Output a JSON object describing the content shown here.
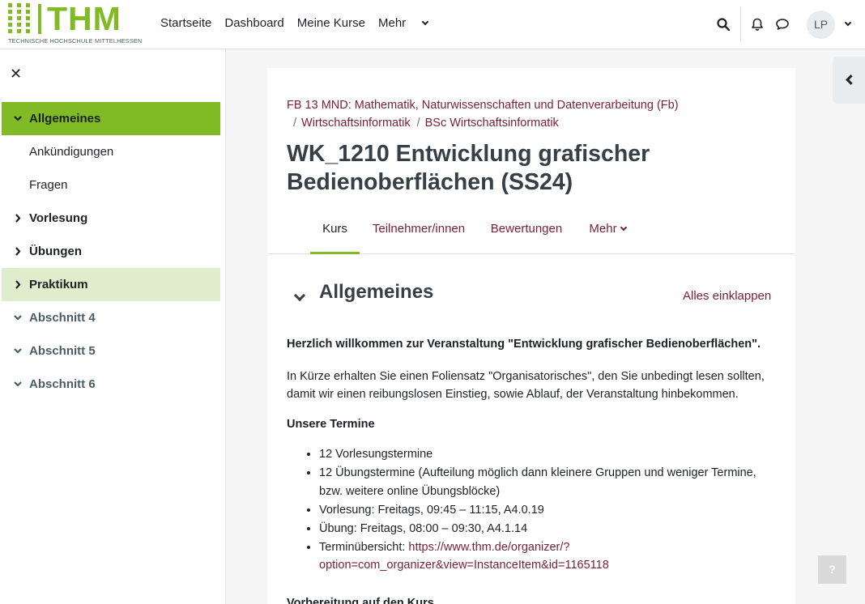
{
  "header": {
    "logo_text": "THM",
    "logo_subtitle": "TECHNISCHE HOCHSCHULE MITTELHESSEN",
    "nav": [
      "Startseite",
      "Dashboard",
      "Meine Kurse",
      "Mehr"
    ],
    "avatar_initials": "LP",
    "icons": [
      "search-icon",
      "bell-icon",
      "message-icon",
      "chevron-down-icon"
    ]
  },
  "drawer": {
    "close_icon": "close-icon",
    "items": [
      {
        "label": "Allgemeines",
        "state": "expanded",
        "bold": true,
        "active": true
      },
      {
        "label": "Ankündigungen",
        "state": "child"
      },
      {
        "label": "Fragen",
        "state": "child"
      },
      {
        "label": "Vorlesung",
        "state": "collapsed",
        "bold": true
      },
      {
        "label": "Übungen",
        "state": "collapsed",
        "bold": true
      },
      {
        "label": "Praktikum",
        "state": "collapsed",
        "bold": true,
        "highlighted": true
      },
      {
        "label": "Abschnitt 4",
        "state": "expanded",
        "bold": true,
        "muted": true
      },
      {
        "label": "Abschnitt 5",
        "state": "expanded",
        "bold": true,
        "muted": true
      },
      {
        "label": "Abschnitt 6",
        "state": "expanded",
        "bold": true,
        "muted": true
      }
    ]
  },
  "course": {
    "breadcrumb": [
      "FB 13 MND: Mathematik, Naturwissenschaften und Datenverarbeitung (Fb)",
      "Wirtschaftsinformatik",
      "BSc Wirtschaftsinformatik"
    ],
    "title_line1": "WK_1210 Entwicklung grafischer",
    "title_line2": "Bedienoberflächen (SS24)",
    "tabs": [
      "Kurs",
      "Teilnehmer/innen",
      "Bewertungen",
      "Mehr"
    ],
    "active_tab": "Kurs"
  },
  "section": {
    "title": "Allgemeines",
    "collapse_all": "Alles einklappen",
    "welcome": "Herzlich willkommen zur Veranstaltung \"Entwicklung grafischer Bedienoberflächen\".",
    "intro_line1": "In Kürze erhalten Sie einen Foliensatz \"Organisatorisches\", den Sie unbedingt lesen sollten,",
    "intro_line2": "damit wir einen reibungslosen Einstieg, sowie Ablauf, der Veranstaltung hinbekommen.",
    "dates_heading": "Unsere Termine",
    "dates": [
      "12 Vorlesungstermine",
      "12 Übungstermine (Aufteilung möglich dann kleinere Gruppen und weniger Termine,",
      "bzw. weitere online Übungsblöcke)",
      "Vorlesung: Freitags, 09:45 – 11:15, A4.0.19",
      "Übung: Freitags, 08:00 – 09:30, A4.1.14"
    ],
    "overview_label": "Terminübersicht: ",
    "overview_link_line1": "https://www.thm.de/organizer/?",
    "overview_link_line2": "option=com_organizer&view=InstanceItem&id=1165118",
    "next_heading": "Vorbereitung auf den Kurs"
  },
  "help_label": "?",
  "colors": {
    "brand_green": "#80ba24",
    "link": "#7a1f33",
    "highlight": "#e0edcc"
  }
}
